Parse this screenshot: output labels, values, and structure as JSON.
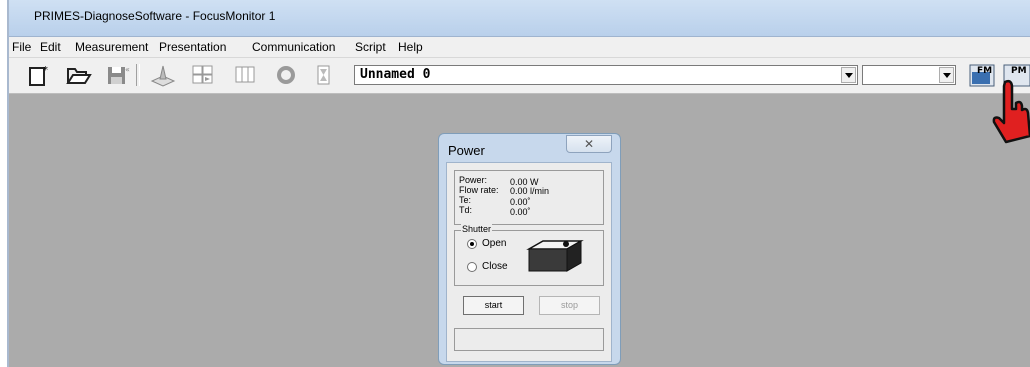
{
  "window": {
    "title": "PRIMES-DiagnoseSoftware - FocusMonitor 1"
  },
  "menu": [
    "File",
    "Edit",
    "Measurement",
    "Presentation",
    "Communication",
    "Script",
    "Help"
  ],
  "toolbar": {
    "icons": [
      "new-document-icon",
      "open-folder-icon",
      "save-icon",
      "3d-view-icon",
      "grid-view-icon",
      "panel-view-icon",
      "circle-icon",
      "hourglass-icon",
      "fm-icon",
      "pm-icon",
      "hand-cursor-icon"
    ],
    "device_combo": "Unnamed 0",
    "second_combo": "",
    "fm_label": "FM",
    "pm_label": "PM"
  },
  "dialog": {
    "title": "Power",
    "close_glyph": "✕",
    "readings": [
      {
        "label": "Power:",
        "value": "0.00 W"
      },
      {
        "label": "Flow rate:",
        "value": "0.00 l/min"
      },
      {
        "label": "Te:",
        "value": "0.00˚"
      },
      {
        "label": "Td:",
        "value": "0.00˚"
      }
    ],
    "shutter": {
      "legend": "Shutter",
      "options": [
        {
          "label": "Open",
          "selected": true
        },
        {
          "label": "Close",
          "selected": false
        }
      ]
    },
    "buttons": {
      "start": "start",
      "stop": "stop"
    },
    "status_text": ""
  },
  "colors": {
    "workspace": "#ababab",
    "dialog_frame": "#c7d8ec",
    "title_bar": "#c4d8ef"
  }
}
